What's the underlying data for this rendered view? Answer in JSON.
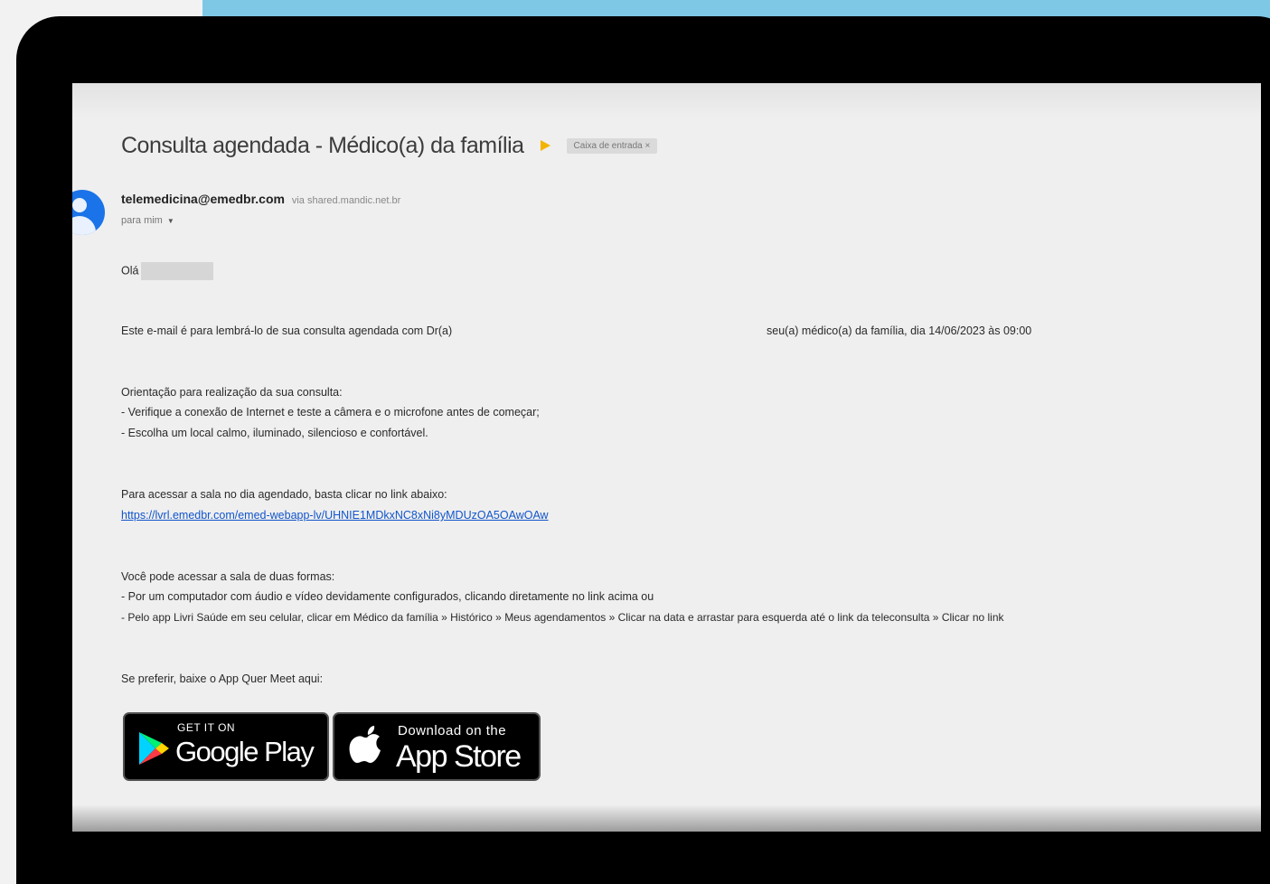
{
  "email": {
    "subject": "Consulta agendada - Médico(a) da família",
    "label_chip": "Caixa de entrada ×",
    "sender": "telemedicina@emedbr.com",
    "via": "via shared.mandic.net.br",
    "recipient": "para mim",
    "greeting": "Olá",
    "intro_left": "Este e-mail é para lembrá-lo de sua consulta agendada com Dr(a)",
    "intro_right": "seu(a) médico(a) da família, dia 14/06/2023 às 09:00",
    "guidance_title": "Orientação para realização da sua consulta:",
    "guidance_1": "- Verifique a conexão de Internet e teste a câmera e o microfone antes de começar;",
    "guidance_2": "- Escolha um local calmo, iluminado, silencioso e confortável.",
    "access_text": "Para acessar a sala no dia agendado, basta clicar no link abaixo:",
    "access_link": "https://lvrl.emedbr.com/emed-webapp-lv/UHNIE1MDkxNC8xNi8yMDUzOA5OAwOAw",
    "ways_title": "Você pode acessar a sala de duas formas:",
    "ways_1": "- Por um computador com áudio e vídeo devidamente configurados, clicando diretamente no link acima ou",
    "ways_2": "- Pelo app Livri Saúde em seu celular, clicar em Médico da família » Histórico » Meus agendamentos » Clicar na data e arrastar para esquerda até o link da teleconsulta » Clicar no link",
    "app_prompt": "Se preferir, baixe o App Quer Meet aqui:"
  },
  "badges": {
    "google_small": "GET IT ON",
    "google_big": "Google Play",
    "apple_small": "Download on the",
    "apple_big": "App Store"
  },
  "colors": {
    "accent_band": "#7ec8e6",
    "link": "#1155cc",
    "avatar": "#1a73e8",
    "importance": "#f3b400"
  },
  "icons": {
    "avatar": "person-icon",
    "importance": "importance-marker-icon",
    "google_play": "google-play-icon",
    "apple": "apple-icon"
  }
}
